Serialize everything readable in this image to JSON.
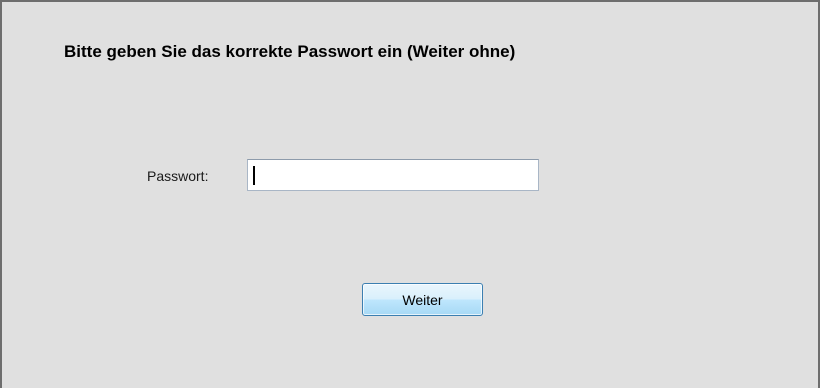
{
  "dialog": {
    "heading": "Bitte geben Sie das korrekte Passwort ein (Weiter ohne)"
  },
  "password": {
    "label": "Passwort:",
    "value": ""
  },
  "buttons": {
    "continue_label": "Weiter"
  },
  "colors": {
    "background": "#e0e0e0",
    "button_border": "#3c7fb1",
    "input_border": "#a9b6c6"
  }
}
